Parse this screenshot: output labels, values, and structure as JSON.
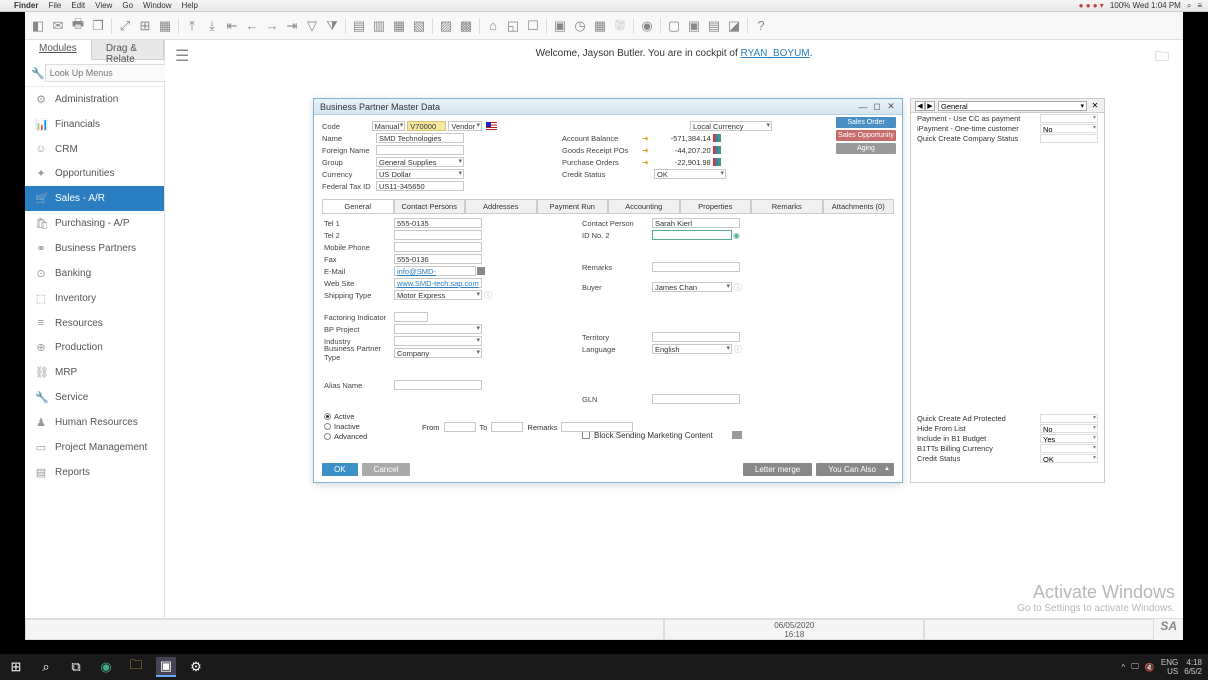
{
  "mac": {
    "app": "Finder",
    "menus": [
      "File",
      "Edit",
      "View",
      "Go",
      "Window",
      "Help"
    ],
    "right": "100%  Wed 1:04 PM"
  },
  "appTabs": {
    "modules": "Modules",
    "drag": "Drag & Relate"
  },
  "search": {
    "placeholder": "Look Up Menus"
  },
  "nav": [
    "Administration",
    "Financials",
    "CRM",
    "Opportunities",
    "Sales - A/R",
    "Purchasing - A/P",
    "Business Partners",
    "Banking",
    "Inventory",
    "Resources",
    "Production",
    "MRP",
    "Service",
    "Human Resources",
    "Project Management",
    "Reports"
  ],
  "welcome": {
    "pre": "Welcome, Jayson Butler. You are in cockpit of ",
    "link": "RYAN_BOYUM",
    "post": "."
  },
  "bp": {
    "title": "Business Partner Master Data",
    "head": {
      "code_lbl": "Code",
      "code_mode": "Manual",
      "code_val": "V70000",
      "code_type": "Vendor",
      "name_lbl": "Name",
      "name_val": "SMD Technologies",
      "fname_lbl": "Foreign Name",
      "fname_val": "",
      "group_lbl": "Group",
      "group_val": "General Supplies",
      "currency_lbl": "Currency",
      "currency_val": "US Dollar",
      "tax_lbl": "Federal Tax ID",
      "tax_val": "US11-345650",
      "curr_sel": "Local Currency",
      "bal_lbl": "Account Balance",
      "bal_val": "-571,384.14",
      "grpo_lbl": "Goods Receipt POs",
      "grpo_val": "-44,207.20",
      "po_lbl": "Purchase Orders",
      "po_val": "-22,901.98",
      "credit_lbl": "Credit Status",
      "credit_val": "OK"
    },
    "btns": {
      "so": "Sales Order",
      "opp": "Sales Opportunity",
      "aging": "Aging"
    },
    "tabs": [
      "General",
      "Contact Persons",
      "Addresses",
      "Payment Run",
      "Accounting",
      "Properties",
      "Remarks",
      "Attachments (0)"
    ],
    "general": {
      "tel1_lbl": "Tel 1",
      "tel1_val": "555-0135",
      "tel2_lbl": "Tel 2",
      "tel2_val": "",
      "mobile_lbl": "Mobile Phone",
      "mobile_val": "",
      "fax_lbl": "Fax",
      "fax_val": "555-0136",
      "email_lbl": "E-Mail",
      "email_val": "info@SMD-tech.sap.com",
      "web_lbl": "Web Site",
      "web_val": "www.SMD-tech.sap.com",
      "ship_lbl": "Shipping Type",
      "ship_val": "Motor Express",
      "factor_lbl": "Factoring Indicator",
      "bpproj_lbl": "BP Project",
      "industry_lbl": "Industry",
      "bptype_lbl": "Business Partner Type",
      "bptype_val": "Company",
      "alias_lbl": "Alias Name",
      "contact_lbl": "Contact Person",
      "contact_val": "Sarah Kierl",
      "idno_lbl": "ID No. 2",
      "idno_val": "",
      "remarks_lbl": "Remarks",
      "buyer_lbl": "Buyer",
      "buyer_val": "James Chan",
      "territory_lbl": "Territory",
      "lang_lbl": "Language",
      "lang_val": "English",
      "gln_lbl": "GLN",
      "block_lbl": "Block Sending Marketing Content",
      "active": "Active",
      "inactive": "Inactive",
      "advanced": "Advanced",
      "from": "From",
      "to": "To",
      "remarks2": "Remarks"
    },
    "footer": {
      "ok": "OK",
      "cancel": "Cancel",
      "letter": "Letter merge",
      "also": "You Can Also"
    }
  },
  "rp": {
    "sel": "General",
    "r1_lbl": "Payment - Use CC as payment",
    "r2_lbl": "iPayment - One-time customer",
    "r2_val": "No",
    "r3_lbl": "Quick Create Company Status",
    "r4_lbl": "Quick Create Ad Protected",
    "r5_lbl": "Hide From List",
    "r5_val": "No",
    "r6_lbl": "Include in B1 Budget",
    "r6_val": "Yes",
    "r7_lbl": "B1TTs Billing Currency",
    "r8_lbl": "Credit Status",
    "r8_val": "OK"
  },
  "status": {
    "date": "06/05/2020",
    "time": "16:18"
  },
  "watermark": {
    "l1": "Activate Windows",
    "l2": "Go to Settings to activate Windows."
  },
  "taskbar": {
    "lang": "ENG",
    "loc": "US",
    "time": "4:18",
    "date": "6/5/2"
  }
}
